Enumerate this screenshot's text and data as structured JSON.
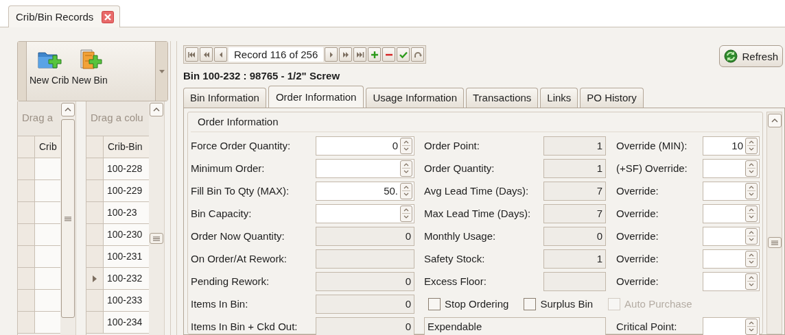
{
  "document_tabs": [
    {
      "label": "Crib/Bin Records",
      "selected": true
    }
  ],
  "toolbar": {
    "buttons": [
      {
        "label": "New Crib",
        "kind": "crib"
      },
      {
        "label": "New Bin",
        "kind": "bin"
      }
    ]
  },
  "crib_grid": {
    "group_hint": "Drag a",
    "columns": [
      "Crib"
    ],
    "rows": [
      {
        "current": false
      },
      {
        "current": false
      },
      {
        "current": false
      },
      {
        "current": false
      },
      {
        "current": false
      },
      {
        "current": false
      },
      {
        "current": false
      },
      {
        "current": false
      }
    ]
  },
  "bin_grid": {
    "group_hint": "Drag a colu",
    "columns": [
      "Crib-Bin"
    ],
    "rows": [
      {
        "crib_bin": "100-228",
        "current": false
      },
      {
        "crib_bin": "100-229",
        "current": false
      },
      {
        "crib_bin": "100-23",
        "current": false
      },
      {
        "crib_bin": "100-230",
        "current": false
      },
      {
        "crib_bin": "100-231",
        "current": false
      },
      {
        "crib_bin": "100-232",
        "current": true
      },
      {
        "crib_bin": "100-233",
        "current": false
      },
      {
        "crib_bin": "100-234",
        "current": false
      }
    ]
  },
  "navigator": {
    "record_text": "Record 116 of 256",
    "buttons": [
      {
        "kind": "first"
      },
      {
        "kind": "prev_page"
      },
      {
        "kind": "prev"
      },
      {
        "kind": "next"
      },
      {
        "kind": "next_page"
      },
      {
        "kind": "last"
      },
      {
        "kind": "add"
      },
      {
        "kind": "delete"
      },
      {
        "kind": "save"
      },
      {
        "kind": "cancel"
      }
    ]
  },
  "refresh_button": {
    "label": "Refresh"
  },
  "record_title": "Bin 100-232 : 98765 - 1/2\" Screw",
  "tabs": [
    {
      "label": "Bin Information",
      "selected": false
    },
    {
      "label": "Order Information",
      "selected": true
    },
    {
      "label": "Usage Information",
      "selected": false
    },
    {
      "label": "Transactions",
      "selected": false
    },
    {
      "label": "Links",
      "selected": false
    },
    {
      "label": "PO History",
      "selected": false
    }
  ],
  "group": {
    "title": "Order Information",
    "rows": [
      {
        "fields": [
          {
            "kind": "spin",
            "label": "Force Order Quantity:",
            "value": "0"
          },
          {
            "kind": "readonly",
            "label": "Order Point:",
            "value": "1"
          },
          {
            "kind": "spin",
            "label": "Override (MIN):",
            "value": "10"
          }
        ]
      },
      {
        "fields": [
          {
            "kind": "spin",
            "label": "Minimum Order:"
          },
          {
            "kind": "readonly",
            "label": "Order Quantity:",
            "value": "1"
          },
          {
            "kind": "spin",
            "label": "(+SF) Override:"
          }
        ]
      },
      {
        "fields": [
          {
            "kind": "spin",
            "label": "Fill Bin To Qty (MAX):",
            "value": "50."
          },
          {
            "kind": "readonly",
            "label": "Avg Lead Time (Days):",
            "value": "7"
          },
          {
            "kind": "spin",
            "label": "Override:"
          }
        ]
      },
      {
        "fields": [
          {
            "kind": "spin",
            "label": "Bin Capacity:"
          },
          {
            "kind": "readonly",
            "label": "Max Lead Time (Days):",
            "value": "7"
          },
          {
            "kind": "spin",
            "label": "Override:"
          }
        ]
      },
      {
        "fields": [
          {
            "kind": "readonly",
            "label": "Order Now Quantity:",
            "value": "0"
          },
          {
            "kind": "readonly",
            "label": "Monthly Usage:",
            "value": "0"
          },
          {
            "kind": "spin",
            "label": "Override:"
          }
        ]
      },
      {
        "fields": [
          {
            "kind": "readonly",
            "label": "On Order/At Rework:"
          },
          {
            "kind": "readonly",
            "label": "Safety Stock:",
            "value": "1"
          },
          {
            "kind": "spin",
            "label": "Override:"
          }
        ]
      },
      {
        "fields": [
          {
            "kind": "readonly",
            "label": "Pending Rework:",
            "value": "0"
          },
          {
            "kind": "readonly",
            "label": "Excess Floor:"
          },
          {
            "kind": "spin",
            "label": "Override:"
          }
        ]
      },
      {
        "fields": [
          {
            "kind": "readonly",
            "label": "Items In Bin:",
            "value": "0"
          },
          {
            "kind": "checkbox",
            "label": "Stop Ordering",
            "checked": false,
            "disabled": false
          },
          {
            "kind": "checkbox",
            "label": "Surplus Bin",
            "checked": false,
            "disabled": false
          },
          {
            "kind": "checkbox",
            "label": "Auto Purchase",
            "checked": false,
            "disabled": true
          }
        ]
      },
      {
        "fields": [
          {
            "kind": "readonly",
            "label": "Items In Bin + Ckd Out:",
            "value": "0"
          },
          {
            "kind": "display",
            "value": "Expendable"
          },
          {
            "kind": "spin",
            "label": "Critical Point:"
          }
        ]
      }
    ]
  }
}
